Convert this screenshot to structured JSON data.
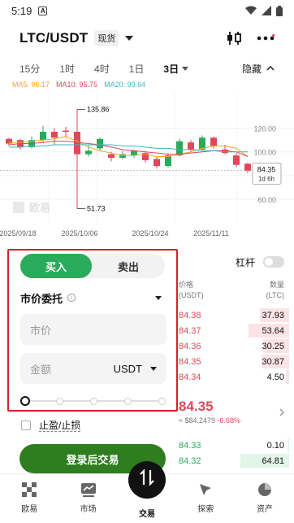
{
  "status_bar": {
    "time": "5:19",
    "badge": "A"
  },
  "header": {
    "pair": "LTC/USDT",
    "market_type": "现货"
  },
  "timeframes": {
    "items": [
      "15分",
      "1时",
      "4时",
      "1日"
    ],
    "active": "3日",
    "hide_label": "隐藏"
  },
  "ma": {
    "ma5": "MA5: 96.17",
    "ma10": "MA10: 95.75",
    "ma20": "MA20: 99.64",
    "colors": {
      "ma5": "#f5a623",
      "ma10": "#e0475a",
      "ma20": "#3bb6c4"
    }
  },
  "chart_data": {
    "type": "candlestick",
    "y_ticks": [
      "120.00",
      "100.00",
      "80.00",
      "60.00"
    ],
    "x_ticks": [
      "2025/09/18",
      "2025/10/06",
      "2025/10/24",
      "2025/11/11"
    ],
    "high_marker": "135.86",
    "low_marker": "51.73",
    "last_price": "84.35",
    "last_price_countdown": "1d 6h",
    "watermark": "欧易",
    "ylim": [
      40,
      150
    ],
    "candles": [
      {
        "o": 111,
        "c": 107,
        "h": 112,
        "l": 105
      },
      {
        "o": 110,
        "c": 104,
        "h": 111,
        "l": 102
      },
      {
        "o": 104,
        "c": 110,
        "h": 113,
        "l": 103
      },
      {
        "o": 110,
        "c": 117,
        "h": 122,
        "l": 108
      },
      {
        "o": 117,
        "c": 112,
        "h": 120,
        "l": 106
      },
      {
        "o": 118,
        "c": 117,
        "h": 121,
        "l": 112
      },
      {
        "o": 117,
        "c": 98,
        "h": 136,
        "l": 52
      },
      {
        "o": 98,
        "c": 101,
        "h": 106,
        "l": 96
      },
      {
        "o": 103,
        "c": 111,
        "h": 112,
        "l": 101
      },
      {
        "o": 98,
        "c": 95,
        "h": 100,
        "l": 92
      },
      {
        "o": 95,
        "c": 98,
        "h": 101,
        "l": 94
      },
      {
        "o": 97,
        "c": 101,
        "h": 102,
        "l": 95
      },
      {
        "o": 99,
        "c": 93,
        "h": 101,
        "l": 91
      },
      {
        "o": 94,
        "c": 88,
        "h": 96,
        "l": 86
      },
      {
        "o": 88,
        "c": 97,
        "h": 99,
        "l": 87
      },
      {
        "o": 97,
        "c": 109,
        "h": 111,
        "l": 96
      },
      {
        "o": 108,
        "c": 102,
        "h": 110,
        "l": 100
      },
      {
        "o": 102,
        "c": 112,
        "h": 114,
        "l": 101
      },
      {
        "o": 112,
        "c": 105,
        "h": 113,
        "l": 103
      },
      {
        "o": 102,
        "c": 99,
        "h": 106,
        "l": 98
      },
      {
        "o": 97,
        "c": 89,
        "h": 99,
        "l": 87
      },
      {
        "o": 90,
        "c": 84,
        "h": 91,
        "l": 82
      }
    ],
    "ma_series": [
      {
        "name": "MA5",
        "color": "#f5a623",
        "values": [
          108,
          108,
          109,
          110,
          111,
          113,
          109,
          104,
          101,
          99,
          97,
          97,
          98,
          96,
          96,
          98,
          100,
          103,
          105,
          105,
          103,
          96
        ]
      },
      {
        "name": "MA10",
        "color": "#e0475a",
        "values": [
          106,
          107,
          107,
          108,
          109,
          109,
          108,
          107,
          106,
          104,
          102,
          101,
          100,
          99,
          98,
          98,
          99,
          100,
          101,
          101,
          100,
          96
        ]
      },
      {
        "name": "MA20",
        "color": "#3bb6c4",
        "values": [
          104,
          104,
          105,
          105,
          106,
          106,
          106,
          106,
          106,
          106,
          105,
          105,
          104,
          103,
          103,
          102,
          102,
          101,
          101,
          100,
          100,
          100
        ]
      }
    ]
  },
  "order": {
    "buy_label": "买入",
    "sell_label": "卖出",
    "order_type": "市价委托",
    "info_icon": "i",
    "price_placeholder": "市价",
    "amount_placeholder": "金额",
    "amount_unit": "USDT",
    "slider_value": 0,
    "tpsl_label": "止盈/止损",
    "login_button": "登录后交易"
  },
  "orderbook": {
    "leverage_label": "杠杆",
    "price_header": "价格\n(USDT)",
    "qty_header": "数量\n(LTC)",
    "asks": [
      {
        "price": "84.38",
        "qty": "37.93",
        "depth": 0.45
      },
      {
        "price": "84.37",
        "qty": "53.64",
        "depth": 0.62
      },
      {
        "price": "84.36",
        "qty": "30.25",
        "depth": 0.4
      },
      {
        "price": "84.35",
        "qty": "30.87",
        "depth": 0.42
      },
      {
        "price": "84.34",
        "qty": "4.50",
        "depth": 0.05
      }
    ],
    "last_price": "84.35",
    "last_price_usd": "≈ $84.2479",
    "change": "-6.68%",
    "bids": [
      {
        "price": "84.33",
        "qty": "0.10",
        "depth": 0.02
      },
      {
        "price": "84.32",
        "qty": "64.81",
        "depth": 0.75
      }
    ]
  },
  "tabbar": {
    "items": [
      {
        "label": "欧易",
        "icon": "okx-logo-icon"
      },
      {
        "label": "市场",
        "icon": "market-chart-icon"
      },
      {
        "label": "交易",
        "icon": "trade-swap-icon"
      },
      {
        "label": "探索",
        "icon": "explore-compass-icon"
      },
      {
        "label": "资产",
        "icon": "assets-pie-icon"
      }
    ]
  }
}
